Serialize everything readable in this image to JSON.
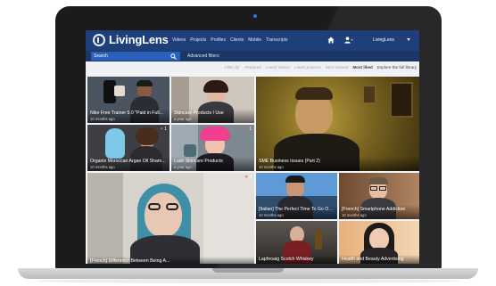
{
  "app": {
    "brand": "LivingLens",
    "nav": [
      "Videos",
      "Projects",
      "Profiles",
      "Clients",
      "Mobile",
      "Transcripts"
    ],
    "account": "LivingLens"
  },
  "search": {
    "placeholder": "Search",
    "advanced_label": "Advanced filters"
  },
  "filters": {
    "items": [
      "Filter by:",
      "Featured",
      "Latest videos",
      "Latest projects",
      "Most viewed",
      "Most liked",
      "Explore the full library"
    ],
    "active": "Most liked"
  },
  "tiles": [
    {
      "title": "Nike Free Trainer 5.0 \"Paid in Full...",
      "age": "10 months ago",
      "likes": ""
    },
    {
      "title": "Skincare Products I Use",
      "age": "a year ago",
      "likes": ""
    },
    {
      "title": "SME Business Issues (Part 2)",
      "age": "10 months ago",
      "likes": ""
    },
    {
      "title": "Organix Moroccan Argan Oil Shamp...",
      "age": "10 months ago",
      "likes": "1"
    },
    {
      "title": "Lush Skincare Products",
      "age": "a year ago",
      "likes": "1"
    },
    {
      "title": "[French] Difference Between Being A...",
      "age": "",
      "likes": "3"
    },
    {
      "title": "[Italian] The Perfect Time To Go On...",
      "age": "10 months ago",
      "likes": ""
    },
    {
      "title": "[French] Smartphone Addiction",
      "age": "10 months ago",
      "likes": ""
    },
    {
      "title": "Laphroaig Scotch Whiskey",
      "age": "",
      "likes": ""
    },
    {
      "title": "Health and Beauty Advertising",
      "age": "",
      "likes": ""
    }
  ],
  "colors": {
    "navbar": "#1f3f7a",
    "searchbar": "#1a3766",
    "like_heart": "#ff4f6a"
  },
  "icons": [
    "logo-icon",
    "home-icon",
    "user-icon",
    "search-icon",
    "heart-icon"
  ]
}
